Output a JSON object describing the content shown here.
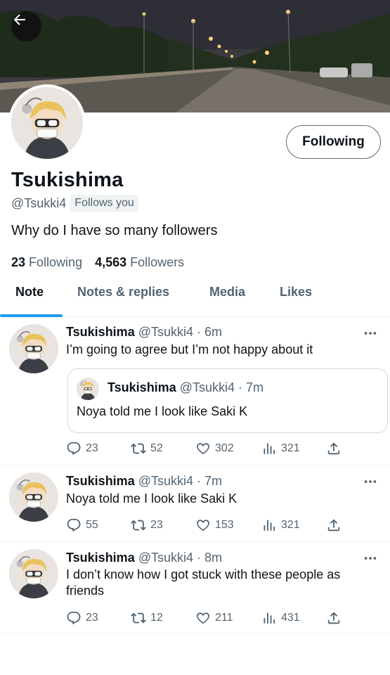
{
  "profile": {
    "name": "Tsukishima",
    "handle": "@Tsukki4",
    "follows_you": "Follows you",
    "bio": "Why do I have so many followers",
    "following_count": "23",
    "following_label": "Following",
    "followers_count": "4,563",
    "followers_label": "Followers",
    "follow_button": "Following"
  },
  "tabs": [
    {
      "label": "Note",
      "active": true
    },
    {
      "label": "Notes & replies",
      "active": false
    },
    {
      "label": "Media",
      "active": false
    },
    {
      "label": "Likes",
      "active": false
    }
  ],
  "tweets": [
    {
      "name": "Tsukishima",
      "meta": "@Tsukki4 · 6m",
      "text": "I’m going to agree but I’m not happy about it",
      "quote": {
        "name": "Tsukishima",
        "meta": "@Tsukki4 · 7m",
        "text": "Noya told me I look like Saki K"
      },
      "replies": "23",
      "retweets": "52",
      "likes": "302",
      "views": "321"
    },
    {
      "name": "Tsukishima",
      "meta": "@Tsukki4 · 7m",
      "text": "Noya told me I look like Saki K",
      "replies": "55",
      "retweets": "23",
      "likes": "153",
      "views": "321"
    },
    {
      "name": "Tsukishima",
      "meta": "@Tsukki4 · 8m",
      "text": "I don’t know how I got stuck with these people as friends",
      "replies": "23",
      "retweets": "12",
      "likes": "211",
      "views": "431"
    }
  ],
  "icons": {
    "back": "arrow-left-icon",
    "more": "more-horizontal-icon",
    "reply": "reply-icon",
    "retweet": "retweet-icon",
    "like": "heart-icon",
    "views": "views-icon",
    "share": "share-icon"
  },
  "colors": {
    "accent": "#1d9bf0",
    "text": "#0f1419",
    "secondary": "#536471"
  }
}
